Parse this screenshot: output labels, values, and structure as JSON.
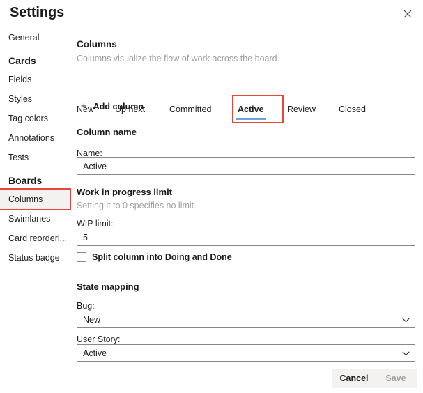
{
  "dialog": {
    "title": "Settings",
    "close_icon": "close-icon"
  },
  "sidebar": {
    "items": [
      {
        "label": "General",
        "type": "item",
        "selected": false
      },
      {
        "label": "Cards",
        "type": "group"
      },
      {
        "label": "Fields",
        "type": "item",
        "selected": false
      },
      {
        "label": "Styles",
        "type": "item",
        "selected": false
      },
      {
        "label": "Tag colors",
        "type": "item",
        "selected": false
      },
      {
        "label": "Annotations",
        "type": "item",
        "selected": false
      },
      {
        "label": "Tests",
        "type": "item",
        "selected": false
      },
      {
        "label": "Boards",
        "type": "group"
      },
      {
        "label": "Columns",
        "type": "item",
        "selected": true
      },
      {
        "label": "Swimlanes",
        "type": "item",
        "selected": false
      },
      {
        "label": "Card reorderi...",
        "type": "item",
        "selected": false
      },
      {
        "label": "Status badge",
        "type": "item",
        "selected": false
      }
    ]
  },
  "main": {
    "heading": "Columns",
    "description": "Columns visualize the flow of work across the board.",
    "add_column": {
      "label": "Add column",
      "icon": "plus-icon"
    },
    "tabs": [
      {
        "label": "New",
        "active": false
      },
      {
        "label": "Up next",
        "active": false
      },
      {
        "label": "Committed",
        "active": false
      },
      {
        "label": "Active",
        "active": true
      },
      {
        "label": "Review",
        "active": false
      },
      {
        "label": "Closed",
        "active": false
      }
    ],
    "column_name": {
      "section_title": "Column name",
      "name_label": "Name:",
      "name_value": "Active"
    },
    "wip": {
      "section_title": "Work in progress limit",
      "helper": "Setting it to 0 specifies no limit.",
      "limit_label": "WIP limit:",
      "limit_value": "5",
      "split_label": "Split column into Doing and Done",
      "split_checked": false
    },
    "state_mapping": {
      "section_title": "State mapping",
      "bug_label": "Bug:",
      "bug_value": "New",
      "user_story_label": "User Story:",
      "user_story_value": "Active"
    }
  },
  "footer": {
    "cancel_label": "Cancel",
    "save_label": "Save"
  },
  "colors": {
    "accent_blue": "#6ba4e2",
    "highlight_red": "#e8453c",
    "muted_text": "#a19f9d",
    "selected_bg": "#f3f2f1"
  }
}
